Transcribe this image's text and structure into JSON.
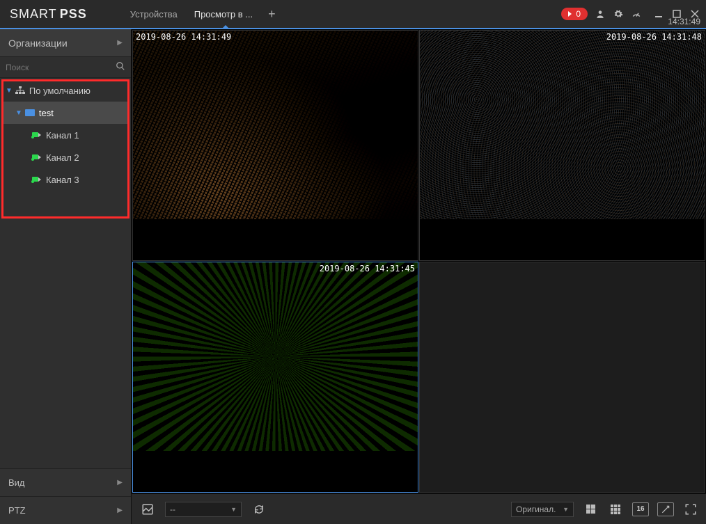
{
  "app": {
    "logo_thin": "SMART",
    "logo_bold": "PSS"
  },
  "tabs": {
    "devices": "Устройства",
    "liveview": "Просмотр в ..."
  },
  "titlebar": {
    "alert_count": "0",
    "clock": "14:31:49"
  },
  "sidebar": {
    "section": "Организации",
    "search_placeholder": "Поиск",
    "defaultGroup": "По умолчанию",
    "device": "test",
    "channels": [
      "Канал 1",
      "Канал 2",
      "Канал 3"
    ],
    "view": "Вид",
    "ptz": "PTZ"
  },
  "video": {
    "timestamps": {
      "cell1": "2019-08-26 14:31:49",
      "cell2": "2019-08-26 14:31:48",
      "cell3": "2019-08-26 14:31:45"
    }
  },
  "toolbar": {
    "combo_left": "--",
    "combo_right": "Оригинал.",
    "layout16": "16"
  }
}
